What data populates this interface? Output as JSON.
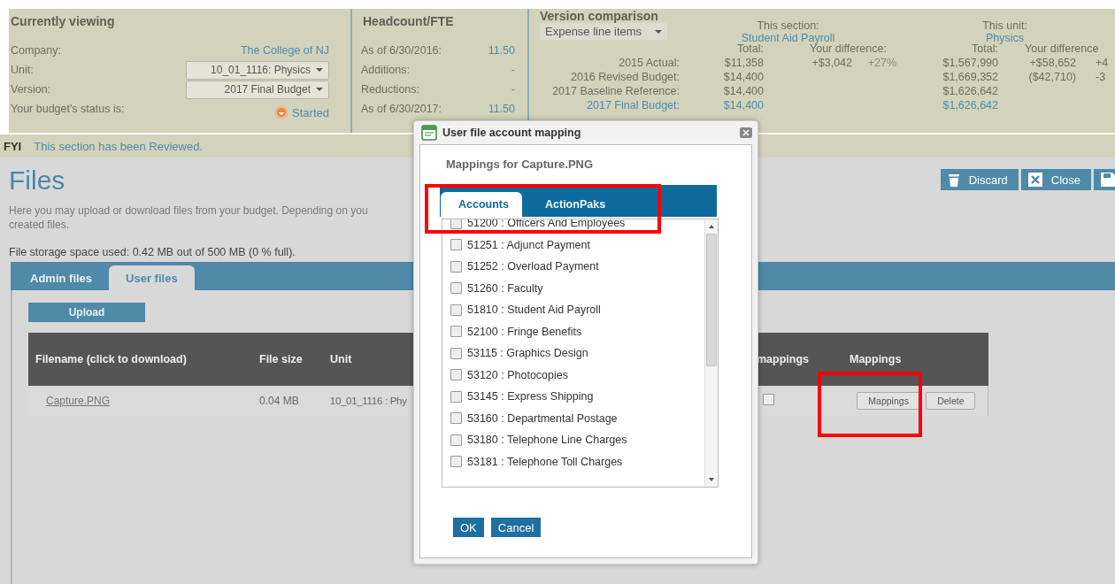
{
  "header": {
    "current": {
      "title": "Currently viewing",
      "rows": [
        {
          "label": "Company:",
          "kind": "link",
          "value": "The College of NJ"
        },
        {
          "label": "Unit:",
          "kind": "select",
          "value": "10_01_1116:  Physics"
        },
        {
          "label": "Version:",
          "kind": "select",
          "value": "2017 Final Budget"
        },
        {
          "label": "Your budget's status is:",
          "kind": "status",
          "value": "Started"
        }
      ]
    },
    "headcount": {
      "title": "Headcount/FTE",
      "rows": [
        {
          "label": "As of 6/30/2016:",
          "value": "11.50"
        },
        {
          "label": "Additions:",
          "value": "-"
        },
        {
          "label": "Reductions:",
          "value": "-"
        },
        {
          "label": "As of 6/30/2017:",
          "value": "11.50"
        }
      ]
    },
    "comparison": {
      "title": "Version comparison",
      "view": "Expense line items",
      "section_heading": "This section:",
      "section_name": "Student Aid Payroll",
      "unit_heading": "This unit:",
      "unit_name": "Physics",
      "columns": [
        "Total:",
        "Your difference:",
        "Total:",
        "Your difference"
      ],
      "rows": [
        {
          "label": "2015 Actual:",
          "highlighted": false,
          "section_total": "$11,358",
          "section_diff": "+$3,042",
          "section_pct": "+27%",
          "unit_total": "$1,567,990",
          "unit_diff": "+$58,652",
          "unit_pct": "+4"
        },
        {
          "label": "2016 Revised Budget:",
          "highlighted": false,
          "section_total": "$14,400",
          "unit_total": "$1,669,352",
          "unit_diff": "($42,710)",
          "unit_pct": "-3"
        },
        {
          "label": "2017 Baseline Reference:",
          "highlighted": false,
          "section_total": "$14,400",
          "unit_total": "$1,626,642"
        },
        {
          "label": "2017 Final Budget:",
          "highlighted": true,
          "section_total": "$14,400",
          "unit_total": "$1,626,642"
        }
      ]
    }
  },
  "notice": {
    "tag": "FYI",
    "text": "This section has been Reviewed."
  },
  "page": {
    "title": "Files",
    "description_lines": [
      "Here you may upload or download files from your budget. Depending on you",
      "created files."
    ],
    "storage": "File storage space used: 0.42 MB out of 500 MB (0 % full).",
    "toolbar": [
      {
        "kind": "discard",
        "label": "Discard"
      },
      {
        "kind": "close",
        "label": "Close"
      },
      {
        "kind": "save"
      }
    ],
    "tabs": [
      {
        "label": "Admin files",
        "selected": false
      },
      {
        "label": "User files",
        "selected": true
      }
    ],
    "upload": "Upload",
    "table": {
      "columns": [
        "Filename (click to download)",
        "File size",
        "Unit",
        "mappings",
        "Mappings"
      ],
      "rows": [
        {
          "filename": "Capture.PNG",
          "size": "0.04 MB",
          "unit": "10_01_1116 : Phy",
          "mapped": false,
          "actions": [
            "Mappings",
            "Delete"
          ]
        }
      ]
    }
  },
  "dialog": {
    "title": "User file account mapping",
    "heading": "Mappings for Capture.PNG",
    "tabs": [
      {
        "label": "Accounts",
        "selected": true
      },
      {
        "label": "ActionPaks",
        "selected": false
      }
    ],
    "accounts": [
      {
        "label": "51200 : Officers And Employees",
        "checked": false
      },
      {
        "label": "51251 : Adjunct Payment",
        "checked": false
      },
      {
        "label": "51252 : Overload Payment",
        "checked": false
      },
      {
        "label": "51260 : Faculty",
        "checked": false
      },
      {
        "label": "51810 : Student Aid Payroll",
        "checked": false
      },
      {
        "label": "52100 : Fringe Benefits",
        "checked": false
      },
      {
        "label": "53115 : Graphics Design",
        "checked": false
      },
      {
        "label": "53120 : Photocopies",
        "checked": false
      },
      {
        "label": "53145 : Express Shipping",
        "checked": false
      },
      {
        "label": "53160 : Departmental Postage",
        "checked": false
      },
      {
        "label": "53180 : Telephone Line Charges",
        "checked": false
      },
      {
        "label": "53181 : Telephone Toll Charges",
        "checked": false
      }
    ],
    "buttons": [
      "OK",
      "Cancel"
    ]
  }
}
